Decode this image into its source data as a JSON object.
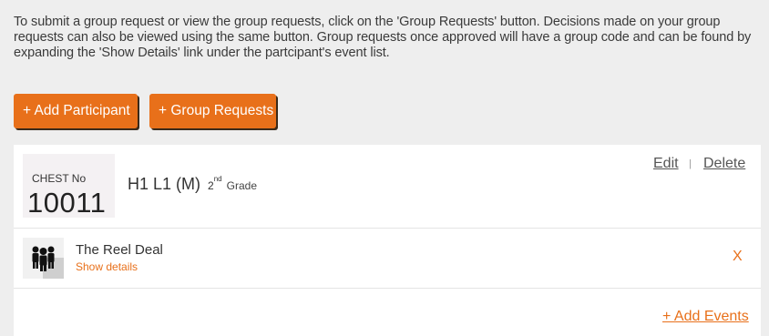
{
  "info_text": "To submit a group request or view the group requests, click on the 'Group Requests' button. Decisions made on your group requests can also be viewed using the same button. Group requests once approved will have a group code and can be found by expanding the 'Show Details' link under the partcipant's event list.",
  "buttons": {
    "add_participant": "+ Add Participant",
    "group_requests": "+ Group Requests"
  },
  "participant": {
    "chest_label": "CHEST No",
    "chest_number": "10011",
    "name": "H1 L1 (M)",
    "grade_number": "2",
    "grade_suffix": "nd",
    "grade_label": "Grade",
    "edit_label": "Edit",
    "separator": "|",
    "delete_label": "Delete"
  },
  "event": {
    "icon": "group-people-icon",
    "name": "The Reel Deal",
    "show_details": "Show details",
    "remove_label": "X"
  },
  "add_events_label": "+ Add Events",
  "colors": {
    "accent": "#e8701a",
    "background": "#eeeeee"
  }
}
